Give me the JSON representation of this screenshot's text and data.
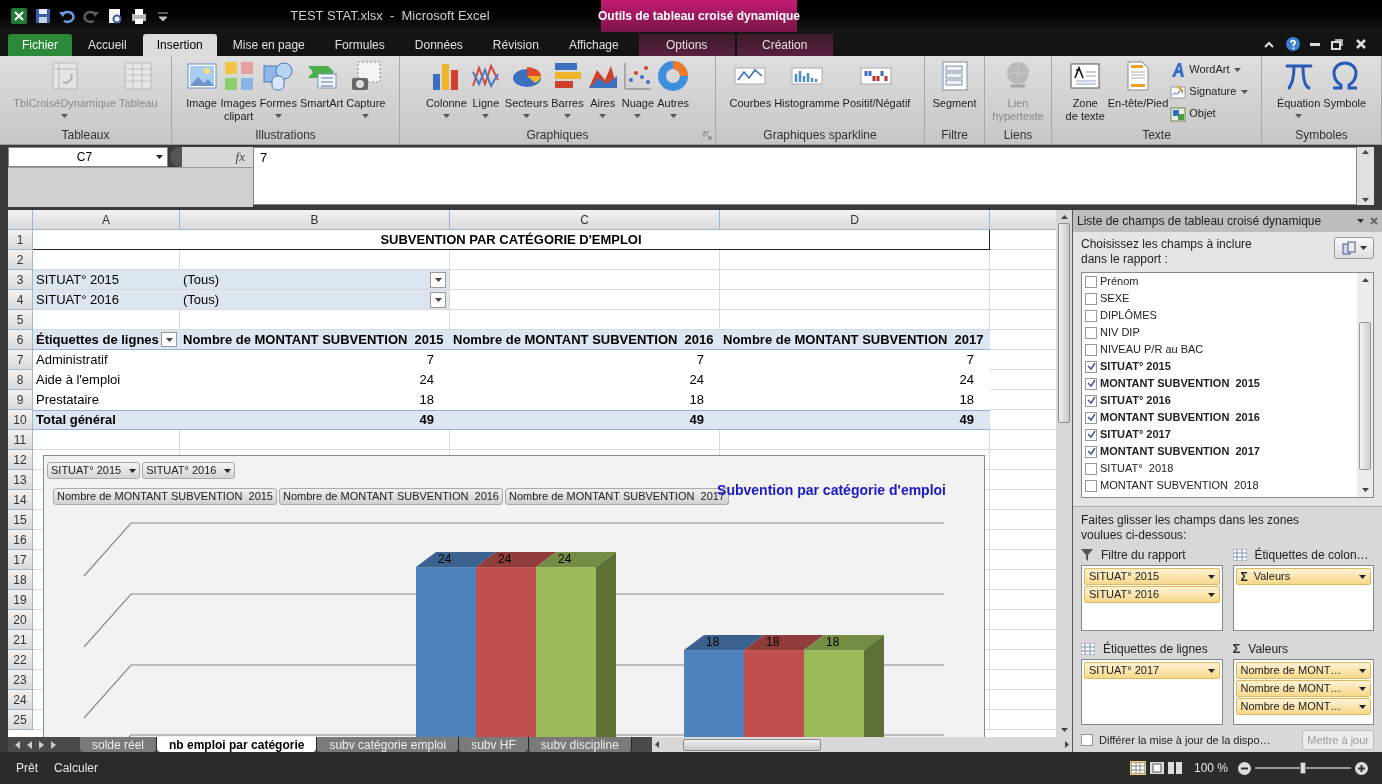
{
  "window": {
    "title": "TEST STAT.xlsx  -  Microsoft Excel",
    "context_header": "Outils de tableau croisé dynamique"
  },
  "tabs": [
    {
      "label": "Fichier",
      "kind": "file",
      "selected": false
    },
    {
      "label": "Accueil",
      "kind": "normal",
      "selected": false
    },
    {
      "label": "Insertion",
      "kind": "normal",
      "selected": true
    },
    {
      "label": "Mise en page",
      "kind": "normal",
      "selected": false
    },
    {
      "label": "Formules",
      "kind": "normal",
      "selected": false
    },
    {
      "label": "Données",
      "kind": "normal",
      "selected": false
    },
    {
      "label": "Révision",
      "kind": "normal",
      "selected": false
    },
    {
      "label": "Affichage",
      "kind": "normal",
      "selected": false
    },
    {
      "label": "Options",
      "kind": "contextual",
      "selected": false
    },
    {
      "label": "Création",
      "kind": "contextual",
      "selected": false
    }
  ],
  "ribbon": [
    {
      "label": "Tableaux",
      "buttons": [
        {
          "kind": "large",
          "lines": [
            "TblCroiséDynamique"
          ],
          "disabled": true,
          "dropdown": true
        },
        {
          "kind": "large",
          "lines": [
            "Tableau"
          ],
          "disabled": true,
          "dropdown": false
        }
      ]
    },
    {
      "label": "Illustrations",
      "buttons": [
        {
          "kind": "large",
          "lines": [
            "Image"
          ],
          "disabled": false,
          "dropdown": false
        },
        {
          "kind": "large",
          "lines": [
            "Images",
            "clipart"
          ],
          "disabled": false,
          "dropdown": false
        },
        {
          "kind": "large",
          "lines": [
            "Formes"
          ],
          "disabled": false,
          "dropdown": true
        },
        {
          "kind": "large",
          "lines": [
            "SmartArt"
          ],
          "disabled": false,
          "dropdown": false
        },
        {
          "kind": "large",
          "lines": [
            "Capture"
          ],
          "disabled": false,
          "dropdown": true
        }
      ]
    },
    {
      "label": "Graphiques",
      "launcher": true,
      "buttons": [
        {
          "kind": "large",
          "lines": [
            "Colonne"
          ],
          "disabled": false,
          "dropdown": true
        },
        {
          "kind": "large",
          "lines": [
            "Ligne"
          ],
          "disabled": false,
          "dropdown": true
        },
        {
          "kind": "large",
          "lines": [
            "Secteurs"
          ],
          "disabled": false,
          "dropdown": true
        },
        {
          "kind": "large",
          "lines": [
            "Barres"
          ],
          "disabled": false,
          "dropdown": true
        },
        {
          "kind": "large",
          "lines": [
            "Aires"
          ],
          "disabled": false,
          "dropdown": true
        },
        {
          "kind": "large",
          "lines": [
            "Nuage"
          ],
          "disabled": false,
          "dropdown": true
        },
        {
          "kind": "large",
          "lines": [
            "Autres"
          ],
          "disabled": false,
          "dropdown": true
        }
      ]
    },
    {
      "label": "Graphiques sparkline",
      "buttons": [
        {
          "kind": "large",
          "lines": [
            "Courbes"
          ],
          "disabled": false,
          "dropdown": false
        },
        {
          "kind": "large",
          "lines": [
            "Histogramme"
          ],
          "disabled": false,
          "dropdown": false
        },
        {
          "kind": "large",
          "lines": [
            "Positif/Négatif"
          ],
          "disabled": false,
          "dropdown": false
        }
      ]
    },
    {
      "label": "Filtre",
      "buttons": [
        {
          "kind": "large",
          "lines": [
            "Segment"
          ],
          "disabled": false,
          "dropdown": false
        }
      ]
    },
    {
      "label": "Liens",
      "buttons": [
        {
          "kind": "large",
          "lines": [
            "Lien",
            "hypertexte"
          ],
          "disabled": true,
          "dropdown": false
        }
      ]
    },
    {
      "label": "Texte",
      "buttons": [
        {
          "kind": "large",
          "lines": [
            "Zone",
            "de texte"
          ],
          "disabled": false,
          "dropdown": false
        },
        {
          "kind": "large",
          "lines": [
            "En-tête/Pied"
          ],
          "disabled": false,
          "dropdown": false
        },
        {
          "kind": "small",
          "lines": [
            "WordArt"
          ],
          "disabled": false,
          "dropdown": true
        },
        {
          "kind": "small",
          "lines": [
            "Signature"
          ],
          "disabled": false,
          "dropdown": true
        },
        {
          "kind": "small",
          "lines": [
            "Objet"
          ],
          "disabled": false,
          "dropdown": false
        }
      ]
    },
    {
      "label": "Symboles",
      "buttons": [
        {
          "kind": "large",
          "lines": [
            "Équation"
          ],
          "disabled": false,
          "dropdown": true
        },
        {
          "kind": "large",
          "lines": [
            "Symbole"
          ],
          "disabled": false,
          "dropdown": false
        }
      ]
    }
  ],
  "formula_bar": {
    "name_box": "C7",
    "function_label": "fx",
    "value": "7"
  },
  "sheet": {
    "columns": [
      "A",
      "B",
      "C",
      "D"
    ],
    "rows": [
      {
        "number": "1",
        "kind": "title",
        "cells": [
          "SUBVENTION PAR CATÉGORIE D'EMPLOI"
        ]
      },
      {
        "number": "2",
        "kind": "blank"
      },
      {
        "number": "3",
        "kind": "filter",
        "cells": [
          "SITUAT° 2015",
          "(Tous)"
        ]
      },
      {
        "number": "4",
        "kind": "filter",
        "cells": [
          "SITUAT° 2016",
          "(Tous)"
        ]
      },
      {
        "number": "5",
        "kind": "blank"
      },
      {
        "number": "6",
        "kind": "header",
        "cells": [
          "Étiquettes de lignes",
          "Nombre de MONTANT SUBVENTION  2015",
          "Nombre de MONTANT SUBVENTION  2016",
          "Nombre de MONTANT SUBVENTION  2017"
        ]
      },
      {
        "number": "7",
        "kind": "data",
        "cells": [
          "Administratif",
          "7",
          "7",
          "7"
        ]
      },
      {
        "number": "8",
        "kind": "data",
        "cells": [
          "Aide à l'emploi",
          "24",
          "24",
          "24"
        ]
      },
      {
        "number": "9",
        "kind": "data",
        "cells": [
          "Prestataire",
          "18",
          "18",
          "18"
        ]
      },
      {
        "number": "10",
        "kind": "total",
        "cells": [
          "Total général",
          "49",
          "49",
          "49"
        ]
      },
      {
        "number": "11",
        "kind": "blank"
      },
      {
        "number": "12",
        "kind": "blank"
      },
      {
        "number": "13",
        "kind": "blank"
      },
      {
        "number": "14",
        "kind": "blank"
      },
      {
        "number": "15",
        "kind": "blank"
      },
      {
        "number": "16",
        "kind": "blank"
      },
      {
        "number": "17",
        "kind": "blank"
      },
      {
        "number": "18",
        "kind": "blank"
      },
      {
        "number": "19",
        "kind": "blank"
      },
      {
        "number": "20",
        "kind": "blank"
      },
      {
        "number": "21",
        "kind": "blank"
      },
      {
        "number": "22",
        "kind": "blank"
      },
      {
        "number": "23",
        "kind": "blank"
      },
      {
        "number": "24",
        "kind": "blank"
      },
      {
        "number": "25",
        "kind": "blank"
      }
    ]
  },
  "chart": {
    "title": "Subvention par catégorie d'emploi",
    "filter_buttons": [
      "SITUAT° 2015",
      "SITUAT° 2016"
    ],
    "value_buttons": [
      "Nombre de MONTANT SUBVENTION  2015",
      "Nombre de MONTANT SUBVENTION  2016",
      "Nombre de MONTANT SUBVENTION  2017"
    ],
    "series": [
      {
        "color": "#4f81bd"
      },
      {
        "color": "#c0504d"
      },
      {
        "color": "#9bbb59"
      }
    ],
    "groups": [
      {
        "labels": [
          "24",
          "24",
          "24"
        ]
      },
      {
        "labels": [
          "18",
          "18",
          "18"
        ]
      }
    ]
  },
  "sheet_tabs": [
    {
      "label": "solde réel",
      "selected": false
    },
    {
      "label": "nb emploi par catégorie",
      "selected": true
    },
    {
      "label": "subv catégorie emploi",
      "selected": false
    },
    {
      "label": "subv HF",
      "selected": false
    },
    {
      "label": "subv discipline",
      "selected": false
    }
  ],
  "field_list": {
    "title": "Liste de champs de tableau croisé dynamique",
    "instruction": "Choisissez les champs à inclure dans le rapport :",
    "fields": [
      {
        "label": "Prénom",
        "checked": false
      },
      {
        "label": "SEXE",
        "checked": false
      },
      {
        "label": "DIPLÔMES",
        "checked": false
      },
      {
        "label": "NIV DIP",
        "checked": false
      },
      {
        "label": "NIVEAU P/R au BAC",
        "checked": false
      },
      {
        "label": "SITUAT° 2015",
        "checked": true
      },
      {
        "label": "MONTANT SUBVENTION  2015",
        "checked": true
      },
      {
        "label": "SITUAT° 2016",
        "checked": true
      },
      {
        "label": "MONTANT SUBVENTION  2016",
        "checked": true
      },
      {
        "label": "SITUAT° 2017",
        "checked": true
      },
      {
        "label": "MONTANT SUBVENTION  2017",
        "checked": true
      },
      {
        "label": "SITUAT°  2018",
        "checked": false
      },
      {
        "label": "MONTANT SUBVENTION  2018",
        "checked": false
      }
    ],
    "drag_hint": "Faites glisser les champs dans les zones voulues ci-dessous:",
    "areas": [
      {
        "kind": "filter",
        "label": "Filtre du rapport",
        "items": [
          {
            "label": "SITUAT° 2015"
          },
          {
            "label": "SITUAT° 2016"
          }
        ]
      },
      {
        "kind": "columns",
        "label": "Étiquettes de colon…",
        "items": [
          {
            "symbol": "Σ",
            "label": "Valeurs"
          }
        ]
      },
      {
        "kind": "rows",
        "label": "Étiquettes de lignes",
        "items": [
          {
            "label": "SITUAT° 2017"
          }
        ]
      },
      {
        "kind": "values",
        "symbol": "Σ",
        "label": "Valeurs",
        "items": [
          {
            "label": "Nombre de MONT…"
          },
          {
            "label": "Nombre de MONT…"
          },
          {
            "label": "Nombre de MONT…"
          }
        ]
      }
    ],
    "defer": {
      "label": "Différer la mise à jour de la dispo…",
      "checked": false
    },
    "update_button": {
      "label": "Mettre à jour",
      "disabled": true
    }
  },
  "status_bar": {
    "items": [
      "Prêt",
      "Calculer"
    ],
    "zoom": "100 %",
    "zoom_slider": {
      "level": 0.5
    }
  }
}
